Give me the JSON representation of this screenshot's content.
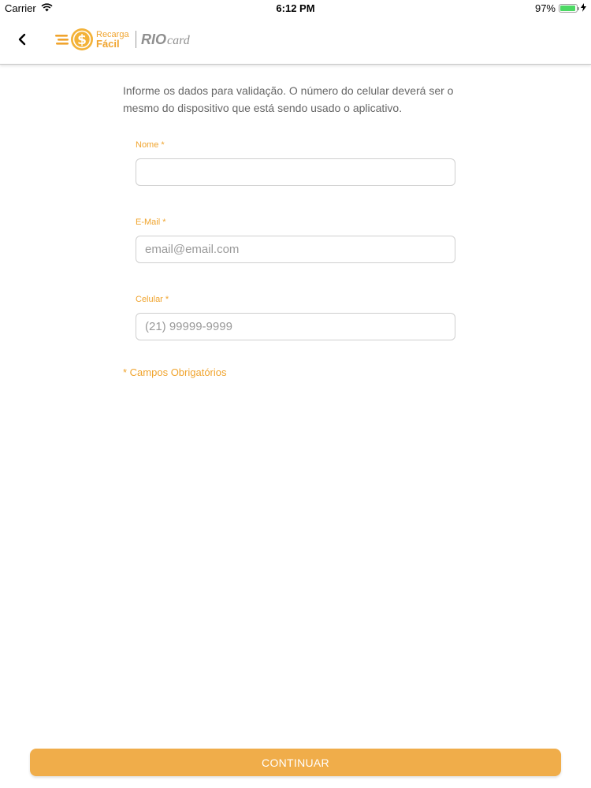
{
  "status_bar": {
    "carrier": "Carrier",
    "time": "6:12 PM",
    "battery_percent": "97%",
    "battery_level": 0.97,
    "icons": [
      "wifi-icon",
      "battery-icon",
      "charging-bolt-icon"
    ]
  },
  "nav": {
    "back_icon": "chevron-left-icon",
    "logo_recarga_line1": "Recarga",
    "logo_recarga_line2": "Fácil",
    "logo_riocard_bold": "RIO",
    "logo_riocard_script": "card"
  },
  "form": {
    "intro": "Informe os dados para validação. O número do celular deverá ser o mesmo do dispositivo que está sendo usado o aplicativo.",
    "fields": [
      {
        "label": "Nome *",
        "value": "",
        "placeholder": ""
      },
      {
        "label": "E-Mail *",
        "value": "",
        "placeholder": "email@email.com"
      },
      {
        "label": "Celular *",
        "value": "",
        "placeholder": "(21) 99999-9999"
      }
    ],
    "required_note": "* Campos Obrigatórios"
  },
  "actions": {
    "continue_label": "CONTINUAR"
  },
  "colors": {
    "accent": "#f0a42e",
    "button": "#f0ad4a",
    "battery": "#4cd964"
  }
}
